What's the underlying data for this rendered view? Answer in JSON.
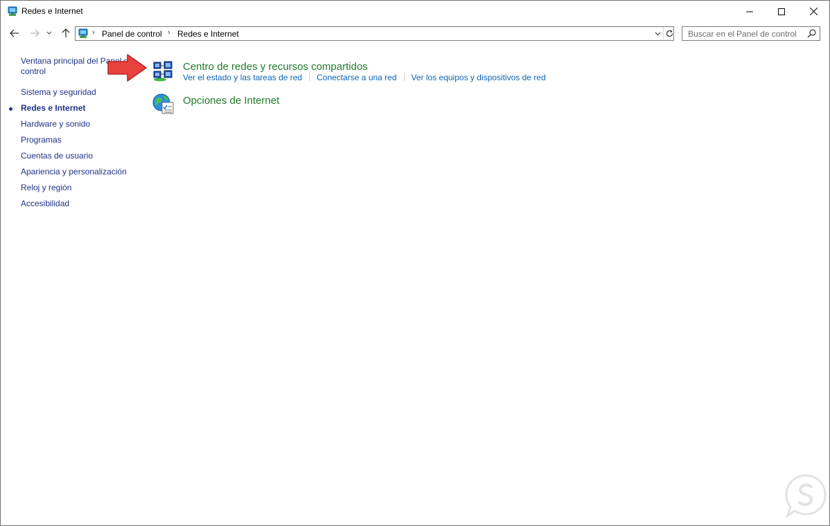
{
  "window": {
    "title": "Redes e Internet",
    "controls": {
      "minimize": "minimize",
      "maximize": "maximize",
      "close": "close"
    }
  },
  "navigation": {
    "breadcrumb": [
      "Panel de control",
      "Redes e Internet"
    ],
    "search_placeholder": "Buscar en el Panel de control"
  },
  "sidebar": {
    "items": [
      {
        "label": "Ventana principal del Panel de control",
        "current": false
      },
      {
        "label": "Sistema y seguridad",
        "current": false
      },
      {
        "label": "Redes e Internet",
        "current": true
      },
      {
        "label": "Hardware y sonido",
        "current": false
      },
      {
        "label": "Programas",
        "current": false
      },
      {
        "label": "Cuentas de usuario",
        "current": false
      },
      {
        "label": "Apariencia y personalización",
        "current": false
      },
      {
        "label": "Reloj y región",
        "current": false
      },
      {
        "label": "Accesibilidad",
        "current": false
      }
    ]
  },
  "categories": [
    {
      "title": "Centro de redes y recursos compartidos",
      "icon": "network-sharing-center-icon",
      "links": [
        "Ver el estado y las tareas de red",
        "Conectarse a una red",
        "Ver los equipos y dispositivos de red"
      ]
    },
    {
      "title": "Opciones de Internet",
      "icon": "internet-options-icon",
      "links": []
    }
  ],
  "colors": {
    "category_title": "#1e7b2a",
    "task_link": "#0b63b5",
    "sidebar_link": "#1e3287",
    "annotation_arrow": "#e8423f",
    "watermark": "#e2e2e2"
  }
}
